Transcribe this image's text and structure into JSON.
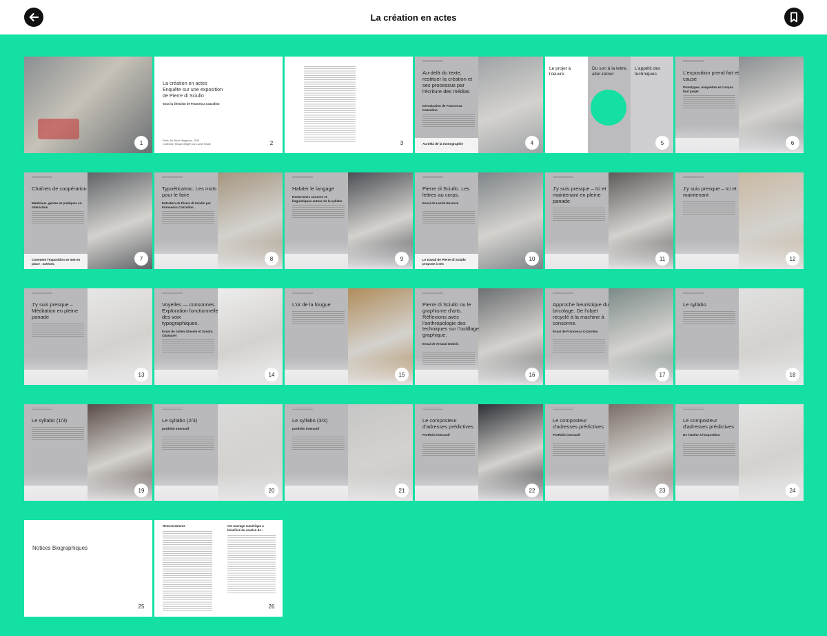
{
  "header": {
    "title": "La création en actes",
    "back_icon": "arrow-left-icon",
    "bookmark_icon": "bookmark-icon"
  },
  "pages": [
    {
      "num": "1",
      "kind": "photo",
      "photo": "#8a8f92",
      "accent": "#c33a3a"
    },
    {
      "num": "2",
      "kind": "title",
      "title": "La création en actes\nEnquête sur une exposition\nde Pierre di Sciullo",
      "subtitle": "Sous la direction de Francesca Cozzolino",
      "foot": "Paris, Art Book Magazine, 2025\nCollection Shape dirigée par Lucile Haute"
    },
    {
      "num": "3",
      "kind": "text"
    },
    {
      "num": "4",
      "kind": "split",
      "heading": "Au-delà du texte, restituer la création et ses processus par l'écriture des médias",
      "sub": "Introduction de Francesca Cozzolino",
      "bottom": "Au-delà de la monographie",
      "photo": "#9fa3a6"
    },
    {
      "num": "5",
      "kind": "columns",
      "cols": [
        "Le projet à l'œuvre",
        "Du son à la lettre, aller-retour",
        "L'appétit des techniques"
      ]
    },
    {
      "num": "6",
      "kind": "split",
      "heading": "L'exposition prend fait et cause",
      "sub": "Prototypes, maquettes et croquis font projet",
      "photo": "#8c9093"
    },
    {
      "num": "7",
      "kind": "split",
      "heading": "Chaînes de coopération",
      "sub": "Matériaux, gestes et pratiques en interaction",
      "bottom": "Comment l'exposition se met en place : acteurs,",
      "photo": "#606468"
    },
    {
      "num": "8",
      "kind": "split",
      "heading": "Typoéticatrac. Les mots pour le faire",
      "sub": "Entretien de Pierre di Sciullo par Francesca Cozzolino",
      "photo": "#a59680"
    },
    {
      "num": "9",
      "kind": "split",
      "heading": "Habiter le langage",
      "sub": "Recherches sonores et linguistiques autour de la syllabe",
      "photo": "#4c4f55"
    },
    {
      "num": "10",
      "kind": "split",
      "heading": "Pierre di Sciullo. Les lettres au corps.",
      "sub": "Essai de Lucile Encrevé",
      "bottom": "Le travail de Pierre di Sciullo propose à ses",
      "photo": "#7f8589"
    },
    {
      "num": "11",
      "kind": "split",
      "heading": "J'y suis presque – Ici et maintenant en pleine panade",
      "photo": "#5e5b5a"
    },
    {
      "num": "12",
      "kind": "split",
      "heading": "J'y suis presque – Ici et maintenant",
      "photo": "#c9b9a3"
    },
    {
      "num": "13",
      "kind": "split",
      "heading": "J'y suis presque – Méditation en pleine panade",
      "photo": "#e7e7e7"
    },
    {
      "num": "14",
      "kind": "split",
      "heading": "Voyelles — consonnes. Exploration fonctionnelle des voix typographiques.",
      "sub": "Essai de Julien Gineste et Sandra Chamaret",
      "photo": "#ededed"
    },
    {
      "num": "15",
      "kind": "split",
      "heading": "L'or de la fougue",
      "photo": "#b08d5c"
    },
    {
      "num": "16",
      "kind": "split",
      "heading": "Pierre di Sciullo ou le graphisme d'arts. Réflexions avec l'anthropologie des techniques sur l'outillage graphique.",
      "sub": "Essai de Arnaud Dubois",
      "photo": "#6d6f72"
    },
    {
      "num": "17",
      "kind": "split",
      "heading": "Approche heuristique du bricolage. De l'objet recyclé à la machine à consonne.",
      "sub": "Essai de Francesca Cozzolino",
      "photo": "#7b8b88"
    },
    {
      "num": "18",
      "kind": "split",
      "heading": "Le syllabo",
      "photo": "#e1e1e1"
    },
    {
      "num": "19",
      "kind": "split",
      "heading": "Le syllabo (1/3)",
      "photo": "#5a4c48"
    },
    {
      "num": "20",
      "kind": "split",
      "heading": "Le syllabo (2/3)",
      "sub": "portfolio interactif",
      "photo": "#dadada"
    },
    {
      "num": "21",
      "kind": "split",
      "heading": "Le syllabo (3/3)",
      "sub": "portfolio interactif",
      "photo": "#c6c6c6"
    },
    {
      "num": "22",
      "kind": "split",
      "heading": "Le composteur d'adresses prédictives",
      "sub": "Portfolio interactif",
      "photo": "#2d3036"
    },
    {
      "num": "23",
      "kind": "split",
      "heading": "Le composteur d'adresses prédictives",
      "sub": "Portfolio interactif",
      "photo": "#7b6e68"
    },
    {
      "num": "24",
      "kind": "split",
      "heading": "Le composteur d'adresses prédictives",
      "sub": "De l'atelier à l'exposition",
      "photo": "#e4e4e4"
    },
    {
      "num": "25",
      "kind": "notice",
      "heading": "Notices Biographiques"
    },
    {
      "num": "26",
      "kind": "credits",
      "left_title": "Remerciements",
      "right_title": "Cet ouvrage numérique a bénéficié du soutien de :"
    }
  ]
}
